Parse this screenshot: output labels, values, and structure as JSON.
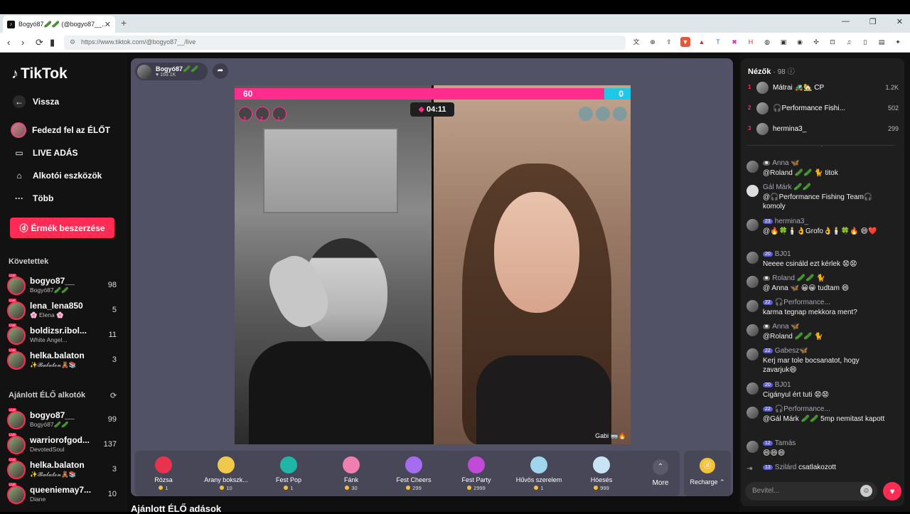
{
  "browser": {
    "tab_title": "Bogyó87🥒🥒 (@bogyo87__...",
    "url": "https://www.tiktok.com/@bogyo87__/live"
  },
  "sidebar": {
    "logo": "TikTok",
    "nav": [
      {
        "label": "Vissza",
        "icon": "back-arrow-icon"
      },
      {
        "label": "Fedezd fel az ÉLŐT",
        "icon": "avatar-icon"
      },
      {
        "label": "LIVE ADÁS",
        "icon": "camera-icon"
      },
      {
        "label": "Alkotói eszközök",
        "icon": "lightbulb-icon"
      },
      {
        "label": "Több",
        "icon": "more-icon"
      }
    ],
    "coins_button": "Érmék beszerzése",
    "following_title": "Követettek",
    "following": [
      {
        "name": "bogyo87__",
        "sub": "Bogyó87🥒🥒",
        "count": "98"
      },
      {
        "name": "lena_lena850",
        "sub": "🌸 Elena 🌸",
        "count": "5"
      },
      {
        "name": "boldizsr.ibol...",
        "sub": "White Angel...",
        "count": "11"
      },
      {
        "name": "helka.balaton",
        "sub": "✨𝓑𝓪𝓵𝓪𝓽𝓸𝓷🧸📚",
        "count": "3"
      }
    ],
    "recommended_title": "Ajánlott ÉLŐ alkotók",
    "recommended": [
      {
        "name": "bogyo87__",
        "sub": "Bogyó87🥒🥒",
        "count": "99"
      },
      {
        "name": "warriorofgod...",
        "sub": "DevotedSoul",
        "count": "137"
      },
      {
        "name": "helka.balaton",
        "sub": "✨𝓑𝓪𝓵𝓪𝓽𝓸𝓷🧸📚",
        "count": "3"
      },
      {
        "name": "queeniemay7...",
        "sub": "Diane",
        "count": "10"
      }
    ]
  },
  "stream": {
    "host_name": "Bogyó87🥒🥒",
    "host_likes": "♥ 169.1K",
    "pk_left": "60",
    "pk_right": "0",
    "timer": "04:11",
    "left_ranks": [
      "3",
      "2",
      "1"
    ],
    "guest_label": "Gabi 🥽🔥"
  },
  "gifts": [
    {
      "name": "Rózsa",
      "price": "1",
      "color": "#e8334e"
    },
    {
      "name": "Arany bokszk...",
      "price": "10",
      "color": "#f0c94a"
    },
    {
      "name": "Fest Pop",
      "price": "1",
      "color": "#1fb6a8"
    },
    {
      "name": "Fánk",
      "price": "30",
      "color": "#ee7fb0"
    },
    {
      "name": "Fest Cheers",
      "price": "299",
      "color": "#a66cf0"
    },
    {
      "name": "Fest Party",
      "price": "2999",
      "color": "#c14bd8"
    },
    {
      "name": "Hűvös szerelem",
      "price": "1",
      "color": "#9fd6ee"
    },
    {
      "name": "Hóesés",
      "price": "999",
      "color": "#c6e4f4"
    }
  ],
  "more_label": "More",
  "recharge_label": "Recharge ⌃",
  "recommended_live_title": "Ajánlott ÉLŐ adások",
  "viewers": {
    "title": "Nézők",
    "count": "· 98",
    "top": [
      {
        "rank": "1",
        "name": "Mátrai 🚜🏡 CP",
        "score": "1.2K"
      },
      {
        "rank": "2",
        "name": "🎧Performance Fishi...",
        "score": "502"
      },
      {
        "rank": "3",
        "name": "hermina3_",
        "score": "299"
      }
    ]
  },
  "chat": [
    {
      "user": "Anna 🦋",
      "level": "",
      "text": "@Roland 🥒🥒 🐈 titok"
    },
    {
      "user": "Gál Márk 🥒🥒",
      "level": "",
      "text": "@🎧Performance Fishing Team🎧 komoly"
    },
    {
      "user": "hermina3_",
      "level": "23",
      "text": "@🔥🍀🕯️👌Grofo👌🕯️🍀🔥 😄❤️"
    },
    {
      "user": "BJ01",
      "level": "20",
      "text": "Neeee csináld ezt kérlek 😧😧"
    },
    {
      "user": "Roland 🥒🥒 🐈",
      "level": "",
      "text": "@ Anna 🦋 😀😀 tudtam 😄"
    },
    {
      "user": "🎧Performance...",
      "level": "22",
      "text": "karma tegnap mekkora ment?"
    },
    {
      "user": "Anna 🦋",
      "level": "",
      "text": "@Roland 🥒🥒 🐈"
    },
    {
      "user": "Gabesz🦋",
      "level": "22",
      "text": "Kerj mar tole bocsanatot, hogy zavarjuk😄"
    },
    {
      "user": "BJ01",
      "level": "20",
      "text": "Cigányul ért tuti 😧😧"
    },
    {
      "user": "🎧Performance...",
      "level": "22",
      "text": "@Gál Márk 🥒🥒 5mp nemitast kapott"
    },
    {
      "user": "Tamás",
      "level": "12",
      "text": "😄😄😄"
    },
    {
      "user": "Szilárd",
      "level": "13",
      "text": "csatlakozott"
    }
  ],
  "chat_input_placeholder": "Bevitel..."
}
